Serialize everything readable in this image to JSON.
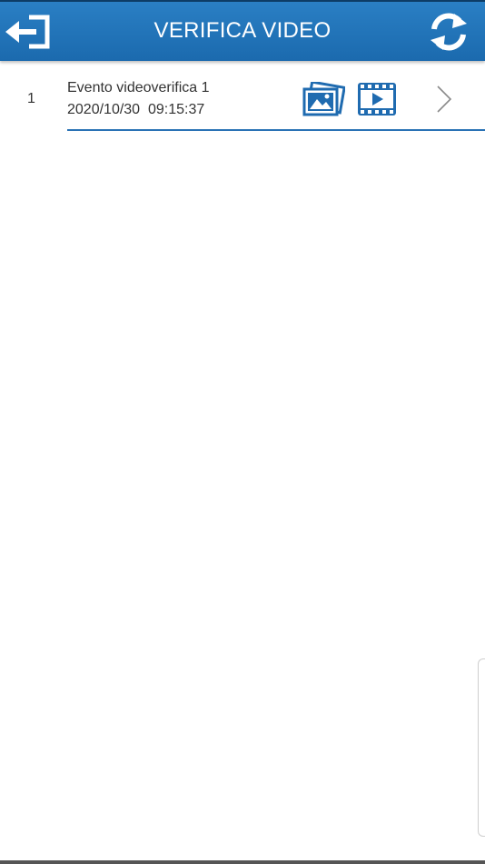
{
  "header": {
    "title": "VERIFICA VIDEO",
    "back_icon": "exit-arrow-icon",
    "refresh_icon": "refresh-icon",
    "background_color": "#1f72b8"
  },
  "events": [
    {
      "index": "1",
      "title": "Evento videoverifica 1",
      "datetime": "2020/10/30  09:15:37",
      "photo_icon": "photo-gallery-icon",
      "video_icon": "video-film-icon",
      "chevron_icon": "chevron-right-icon"
    }
  ],
  "colors": {
    "accent": "#1f6bb0",
    "text": "#333333",
    "divider": "#2a72b5"
  }
}
